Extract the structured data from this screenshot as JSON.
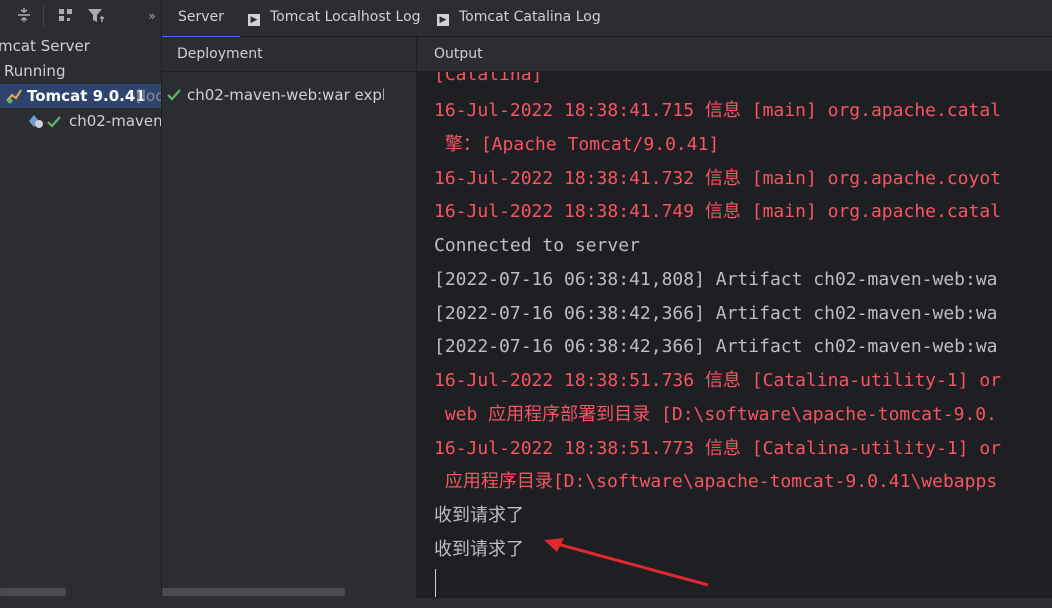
{
  "tabs": [
    {
      "label": "Server"
    },
    {
      "label": "Tomcat Localhost Log"
    },
    {
      "label": "Tomcat Catalina Log"
    }
  ],
  "left_tree": {
    "root": "mcat Server",
    "running": "Running",
    "server_name": "Tomcat 9.0.41",
    "server_suffix": "[loc",
    "artifact": "ch02-maven-"
  },
  "deployment": {
    "header": "Deployment",
    "item": "ch02-maven-web:war explo"
  },
  "output": {
    "header": "Output",
    "lines": [
      {
        "text": "[Catalina]",
        "kind": "red"
      },
      {
        "text": "16-Jul-2022 18:38:41.715 信息 [main] org.apache.catal",
        "kind": "red"
      },
      {
        "text": " 擎：[Apache Tomcat/9.0.41]",
        "kind": "red"
      },
      {
        "text": "16-Jul-2022 18:38:41.732 信息 [main] org.apache.coyot",
        "kind": "red"
      },
      {
        "text": "16-Jul-2022 18:38:41.749 信息 [main] org.apache.catal",
        "kind": "red"
      },
      {
        "text": "Connected to server",
        "kind": "norm"
      },
      {
        "text": "[2022-07-16 06:38:41,808] Artifact ch02-maven-web:wa",
        "kind": "norm"
      },
      {
        "text": "[2022-07-16 06:38:42,366] Artifact ch02-maven-web:wa",
        "kind": "norm"
      },
      {
        "text": "[2022-07-16 06:38:42,366] Artifact ch02-maven-web:wa",
        "kind": "norm"
      },
      {
        "text": "16-Jul-2022 18:38:51.736 信息 [Catalina-utility-1] or",
        "kind": "red"
      },
      {
        "text": " web 应用程序部署到目录 [D:\\software\\apache-tomcat-9.0.",
        "kind": "red"
      },
      {
        "text": "16-Jul-2022 18:38:51.773 信息 [Catalina-utility-1] or",
        "kind": "red"
      },
      {
        "text": " 应用程序目录[D:\\software\\apache-tomcat-9.0.41\\webapps",
        "kind": "red"
      },
      {
        "text": "收到请求了",
        "kind": "norm"
      },
      {
        "text": "收到请求了",
        "kind": "norm"
      }
    ]
  },
  "colors": {
    "accent": "#3574f0",
    "error": "#f75464",
    "success": "#5fb865",
    "annotation_arrow": "#e0282e"
  },
  "icons": [
    "collapse-icon",
    "group-icon",
    "filter-icon",
    "more-icon",
    "tomcat-icon",
    "artifact-icon",
    "check-icon",
    "deploy-icon",
    "undeploy-icon",
    "refresh-icon",
    "update-icon"
  ]
}
